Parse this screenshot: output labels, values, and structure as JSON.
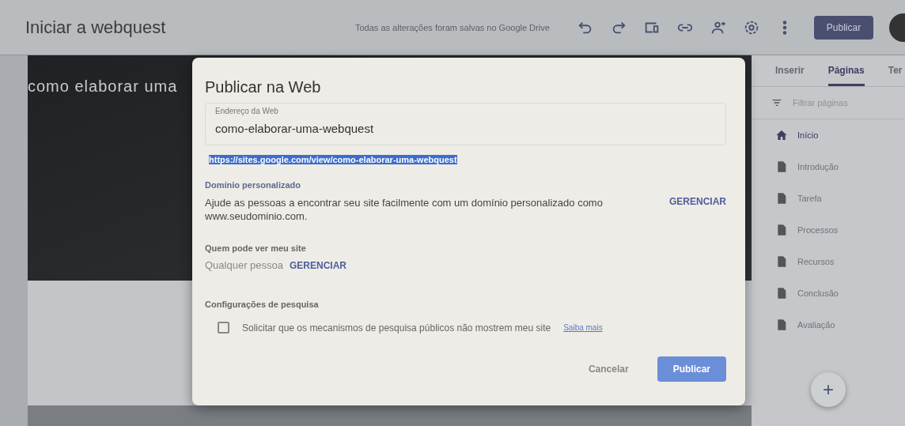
{
  "topbar": {
    "title": "Iniciar a webquest",
    "status": "Todas as alterações foram salvas no Google Drive",
    "publish": "Publicar"
  },
  "hero": {
    "title": "como elaborar uma"
  },
  "side_panel": {
    "tabs": [
      {
        "label": "Inserir",
        "selected": false
      },
      {
        "label": "Páginas",
        "selected": true
      },
      {
        "label": "Ter",
        "selected": false
      }
    ],
    "filter": {
      "placeholder": "Filtrar páginas"
    },
    "pages": [
      {
        "label": "Início",
        "kind": "home",
        "selected": true
      },
      {
        "label": "Introdução",
        "kind": "page",
        "selected": false
      },
      {
        "label": "Tarefa",
        "kind": "page",
        "selected": false
      },
      {
        "label": "Processos",
        "kind": "page",
        "selected": false
      },
      {
        "label": "Recursos",
        "kind": "page",
        "selected": false
      },
      {
        "label": "Conclusão",
        "kind": "page",
        "selected": false
      },
      {
        "label": "Avaliação",
        "kind": "page",
        "selected": false
      }
    ],
    "add": "+"
  },
  "dialog": {
    "title": "Publicar na Web",
    "address": {
      "label": "Endereço da Web",
      "value": "como-elaborar-uma-webquest"
    },
    "url": "https://sites.google.com/view/como-elaborar-uma-webquest",
    "domain": {
      "heading": "Domínio personalizado",
      "text": "Ajude as pessoas a encontrar seu site facilmente com um domínio personalizado como www.seudominio.com.",
      "action": "GERENCIAR"
    },
    "visibility": {
      "heading": "Quem pode ver meu site",
      "value": "Qualquer pessoa",
      "action": "GERENCIAR"
    },
    "search": {
      "heading": "Configurações de pesquisa",
      "label": "Solicitar que os mecanismos de pesquisa públicos não mostrem meu site",
      "checked": false,
      "link": "Saiba mais"
    },
    "buttons": {
      "cancel": "Cancelar",
      "publish": "Publicar"
    }
  }
}
